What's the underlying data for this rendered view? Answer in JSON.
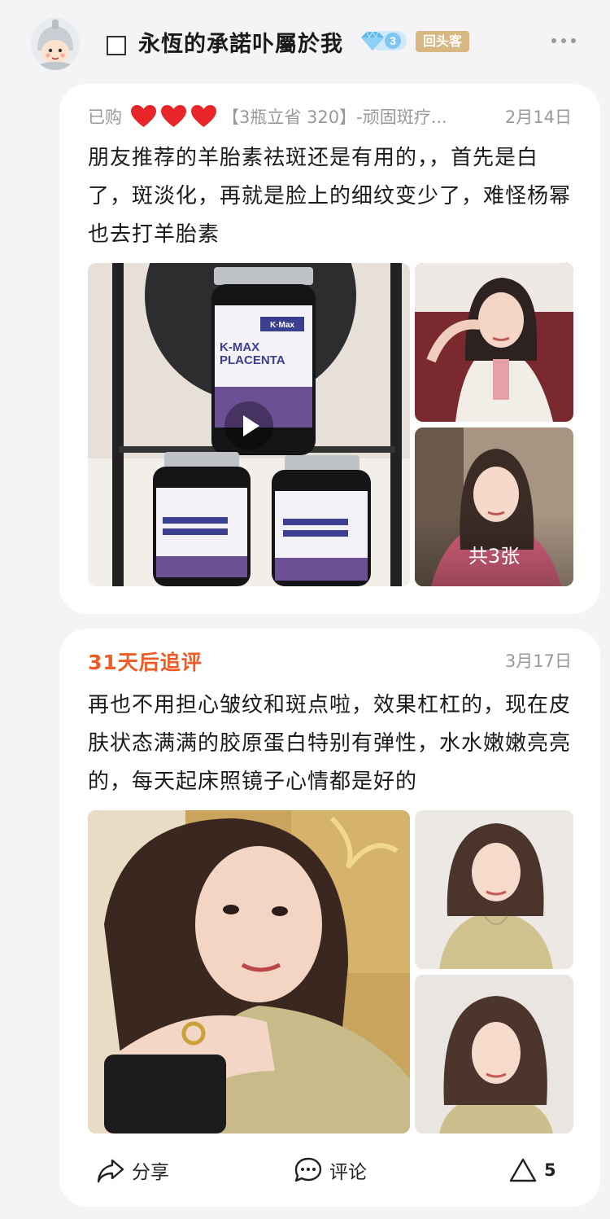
{
  "user": {
    "name": "永恆的承諾卟屬於我",
    "vip_level": "3",
    "badge": "回头客",
    "avatar_icon": "cartoon-helmet-avatar-icon"
  },
  "review": {
    "purchased_label": "已购",
    "hearts": 3,
    "spec": "【3瓶立省 320】-顽固斑疗...",
    "date": "2月14日",
    "text": "朋友推荐的羊胎素祛斑还是有用的，，首先是白了，斑淡化，再就是脸上的细纹变少了，难怪杨幂也去打羊胎素",
    "image_count": "共3张",
    "product_label_brand": "K·Max",
    "product_label_name_1": "K-MAX",
    "product_label_name_2": "PLACENTA"
  },
  "followup": {
    "title": "31天后追评",
    "date": "3月17日",
    "text": "再也不用担心皱纹和斑点啦，效果杠杠的，现在皮肤状态满满的胶原蛋白特别有弹性，水水嫩嫩亮亮的，每天起床照镜子心情都是好的"
  },
  "actions": {
    "share": "分享",
    "comment": "评论",
    "like_count": "5"
  },
  "colors": {
    "accent_orange": "#ef5a25",
    "heart_red": "#e8262a",
    "badge_gold": "#d9b782",
    "vip_blue": "#6ec3f0"
  }
}
